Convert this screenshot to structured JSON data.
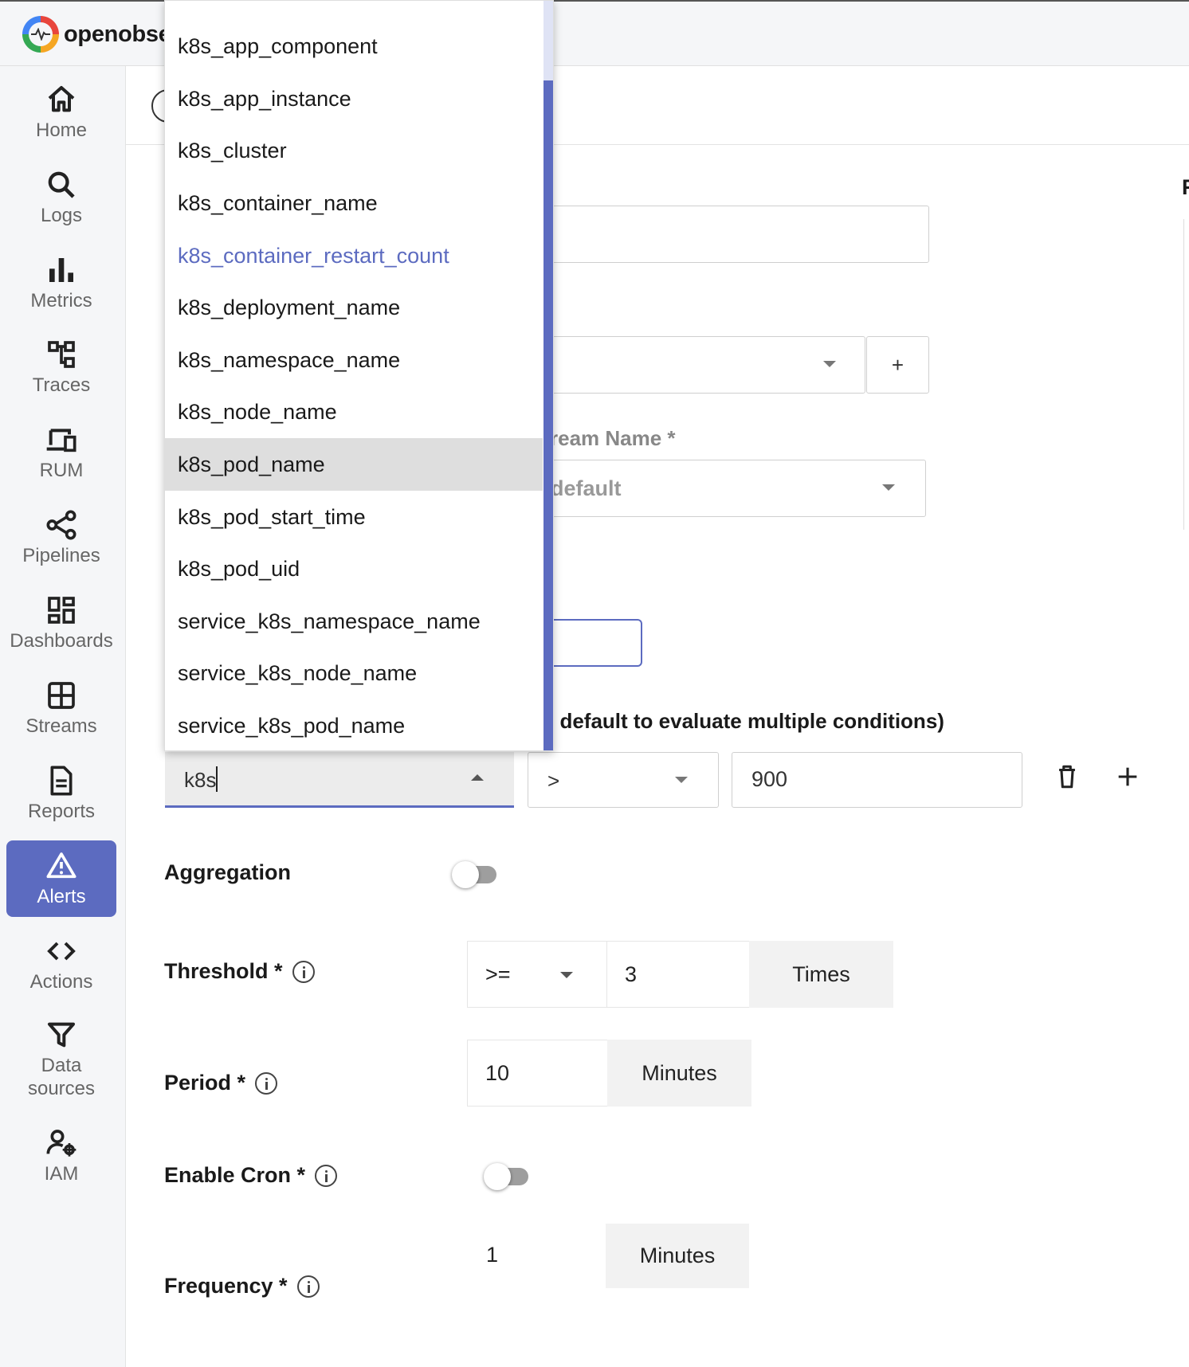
{
  "app": {
    "logo_text": "openobse"
  },
  "sidebar": {
    "items": [
      {
        "label": "Home",
        "icon": "home-icon"
      },
      {
        "label": "Logs",
        "icon": "search-icon"
      },
      {
        "label": "Metrics",
        "icon": "bar-chart-icon"
      },
      {
        "label": "Traces",
        "icon": "traces-icon"
      },
      {
        "label": "RUM",
        "icon": "devices-icon"
      },
      {
        "label": "Pipelines",
        "icon": "share-icon"
      },
      {
        "label": "Dashboards",
        "icon": "dashboard-icon"
      },
      {
        "label": "Streams",
        "icon": "grid-icon"
      },
      {
        "label": "Reports",
        "icon": "document-icon"
      },
      {
        "label": "Alerts",
        "icon": "warning-icon",
        "active": true
      },
      {
        "label": "Actions",
        "icon": "code-icon"
      },
      {
        "label": "Data sources",
        "line1": "Data",
        "line2": "sources",
        "icon": "filter-icon"
      },
      {
        "label": "IAM",
        "icon": "user-settings-icon"
      }
    ]
  },
  "form": {
    "stream_name_label": "ream Name *",
    "stream_name_value": "default",
    "add_label": "+",
    "conditions_hint": "/ default to evaluate multiple conditions)",
    "condition": {
      "column_value": "k8s",
      "operator": ">",
      "value": "900"
    },
    "aggregation_label": "Aggregation",
    "threshold_label": "Threshold *",
    "threshold_operator": ">=",
    "threshold_value": "3",
    "threshold_unit": "Times",
    "period_label": "Period *",
    "period_value": "10",
    "period_unit": "Minutes",
    "cron_label": "Enable Cron *",
    "frequency_label": "Frequency *",
    "frequency_value": "1",
    "frequency_unit": "Minutes",
    "right_edge_letter": "F"
  },
  "dropdown": {
    "options": [
      "k8s_app_component",
      "k8s_app_instance",
      "k8s_cluster",
      "k8s_container_name",
      "k8s_container_restart_count",
      "k8s_deployment_name",
      "k8s_namespace_name",
      "k8s_node_name",
      "k8s_pod_name",
      "k8s_pod_start_time",
      "k8s_pod_uid",
      "service_k8s_namespace_name",
      "service_k8s_node_name",
      "service_k8s_pod_name"
    ],
    "selected": "k8s_container_restart_count",
    "highlighted": "k8s_pod_name"
  },
  "colors": {
    "accent": "#5c6bc0",
    "sidebar_bg": "#f5f6f8"
  }
}
